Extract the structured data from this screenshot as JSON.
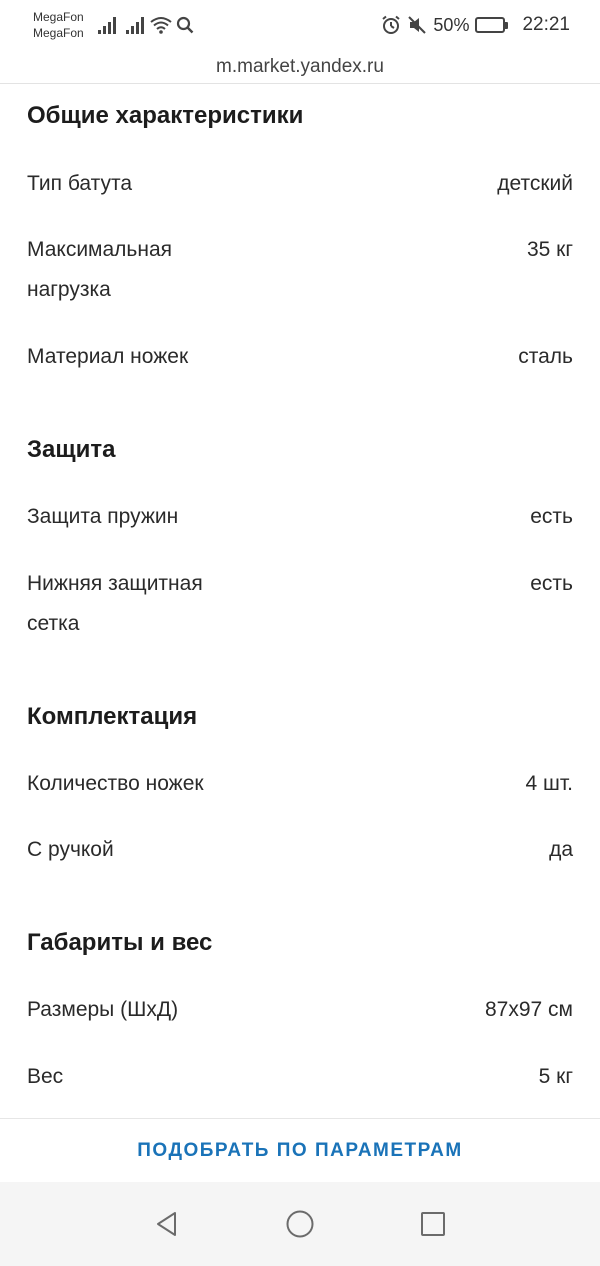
{
  "status": {
    "carrier1": "MegaFon",
    "carrier2": "MegaFon",
    "battery_percent_text": "50%",
    "battery_level": 0.5,
    "time": "22:21"
  },
  "browser": {
    "url": "m.market.yandex.ru"
  },
  "sections": [
    {
      "title": "Общие характеристики",
      "rows": [
        {
          "label": "Тип батута",
          "value": "детский"
        },
        {
          "label": "Максимальная нагрузка",
          "value": "35 кг"
        },
        {
          "label": "Материал ножек",
          "value": "сталь"
        }
      ]
    },
    {
      "title": "Защита",
      "rows": [
        {
          "label": "Защита пружин",
          "value": "есть"
        },
        {
          "label": "Нижняя защитная сетка",
          "value": "есть"
        }
      ]
    },
    {
      "title": "Комплектация",
      "rows": [
        {
          "label": "Количество ножек",
          "value": "4 шт."
        },
        {
          "label": "С ручкой",
          "value": "да"
        }
      ]
    },
    {
      "title": "Габариты и вес",
      "rows": [
        {
          "label": "Размеры (ШхД)",
          "value": "87x97 см"
        },
        {
          "label": "Вес",
          "value": "5 кг"
        }
      ]
    }
  ],
  "action": {
    "label": "ПОДОБРАТЬ ПО ПАРАМЕТРАМ",
    "color": "#1a73b8"
  },
  "nav": {
    "back_icon": "triangle-back-icon",
    "home_icon": "circle-home-icon",
    "recents_icon": "square-recents-icon"
  }
}
